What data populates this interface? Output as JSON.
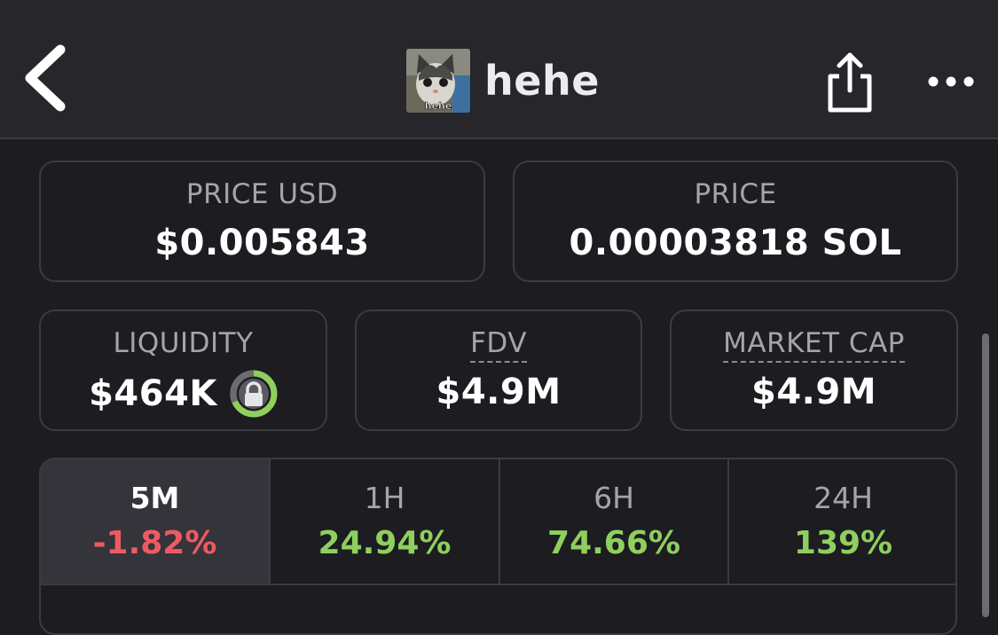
{
  "header": {
    "token_name": "hehe",
    "avatar_caption": "hehe",
    "back_icon": "chevron-left-icon",
    "share_icon": "share-icon",
    "more_icon": "more-horizontal-icon"
  },
  "stats": {
    "price_usd": {
      "label": "PRICE USD",
      "value": "$0.005843"
    },
    "price": {
      "label": "PRICE",
      "value": "0.00003818 SOL"
    },
    "liquidity": {
      "label": "LIQUIDITY",
      "value": "$464K",
      "lock_icon": "lock-icon"
    },
    "fdv": {
      "label": "FDV",
      "value": "$4.9M"
    },
    "market_cap": {
      "label": "MARKET CAP",
      "value": "$4.9M"
    }
  },
  "timeframes": [
    {
      "label": "5M",
      "change": "-1.82%",
      "active": true,
      "color": "#ee5a63"
    },
    {
      "label": "1H",
      "change": "24.94%",
      "active": false,
      "color": "#8fcf5e"
    },
    {
      "label": "6H",
      "change": "74.66%",
      "active": false,
      "color": "#8fcf5e"
    },
    {
      "label": "24H",
      "change": "139%",
      "active": false,
      "color": "#8fcf5e"
    }
  ],
  "colors": {
    "positive": "#8fcf5e",
    "negative": "#ee5a63",
    "lock_ring": "#8fcf5e"
  }
}
